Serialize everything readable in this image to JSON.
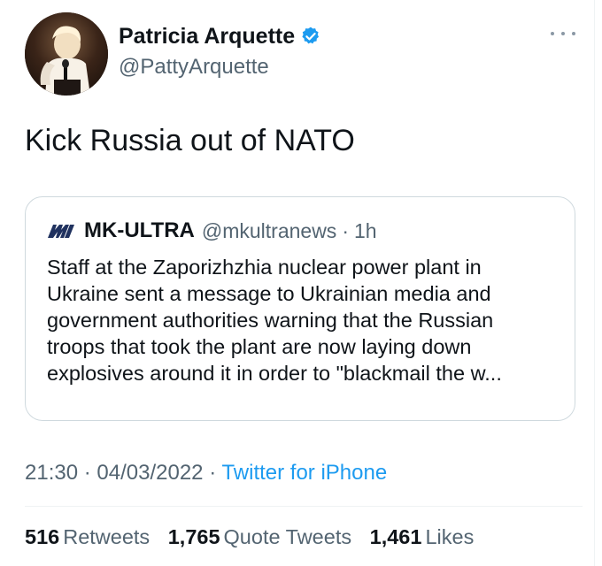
{
  "author": {
    "display_name": "Patricia Arquette",
    "handle": "@PattyArquette",
    "verified": true,
    "avatar": "profile-photo"
  },
  "tweet": {
    "text": "Kick Russia out of NATO"
  },
  "quote": {
    "name": "MK-ULTRA",
    "handle": "@mkultranews",
    "separator": "·",
    "time": "1h",
    "logo": "mk-logo-icon",
    "lines": [
      "Staff at the Zaporizhzhia nuclear power plant in",
      "Ukraine sent a message to Ukrainian media and",
      "government authorities warning that the Russian",
      "troops that took the plant are now laying down",
      "explosives around it in order to \"blackmail the w..."
    ]
  },
  "meta": {
    "time": "21:30",
    "separator": "·",
    "date": "04/03/2022",
    "source": "Twitter for iPhone"
  },
  "stats": {
    "retweets_count": "516",
    "retweets_label": "Retweets",
    "quotes_count": "1,765",
    "quotes_label": "Quote Tweets",
    "likes_count": "1,461",
    "likes_label": "Likes"
  },
  "colors": {
    "text": "#0f1419",
    "secondary": "#536471",
    "link": "#1d9bf0",
    "verified": "#1d9bf0",
    "border": "#cfd9de"
  }
}
